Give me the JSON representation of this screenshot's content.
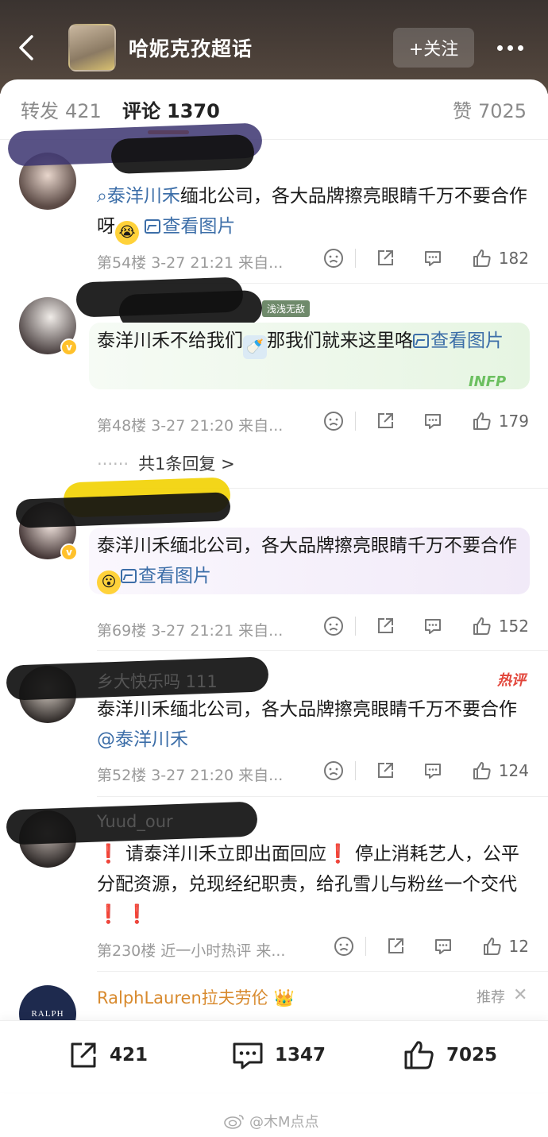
{
  "header": {
    "title": "哈妮克孜超话",
    "follow_label": "+关注",
    "icons": {
      "back": "chevron-left-icon",
      "more": "more-dots-icon"
    }
  },
  "tabs": [
    {
      "label": "转发",
      "count": "421"
    },
    {
      "label": "评论",
      "count": "1370"
    },
    {
      "label": "赞",
      "count": "7025"
    }
  ],
  "comments": [
    {
      "username": "",
      "text_link": "泰洋川禾",
      "text_rest": "缅北公司，各大品牌擦亮眼睛千万不要合作呀",
      "image_link": "查看图片",
      "meta": "第54楼 3-27 21:21 来自...",
      "likes": "182"
    },
    {
      "username": "",
      "badge_text": "浅浅无敌",
      "text": "泰洋川禾不给我们",
      "text_after": "那我们就来这里咯",
      "image_link": "查看图片",
      "meta": "第48楼 3-27 21:20 来自...",
      "likes": "179",
      "reply_link": "共1条回复 >"
    },
    {
      "username": "",
      "text": "泰洋川禾缅北公司，各大品牌擦亮眼睛千万不要合作",
      "image_link": "查看图片",
      "meta": "第69楼 3-27 21:21 来自...",
      "likes": "152"
    },
    {
      "username": "乡大快乐吗 111",
      "hot_label": "热评",
      "text": "泰洋川禾缅北公司，各大品牌擦亮眼睛千万不要合作",
      "mention": "@泰洋川禾",
      "meta": "第52楼 3-27 21:20 来自...",
      "likes": "124"
    },
    {
      "username": "Yuud_our",
      "text_1": "请泰洋川禾立即出面回应",
      "text_2": "停止消耗艺人，公平分配资源，兑现经纪职责，给孔雪儿与粉丝一个交代",
      "excl": "❗",
      "meta": "第230楼 近一小时热评 来...",
      "likes": "12"
    }
  ],
  "ad": {
    "name": "RalphLauren拉夫劳伦",
    "avatar_text": "RALPH",
    "tag": "推荐",
    "close": "✕"
  },
  "bottom_bar": {
    "repost_count": "421",
    "comment_count": "1347",
    "like_count": "7025"
  },
  "watermark": "@木M点点",
  "colors": {
    "accent": "#ff8200",
    "link": "#3c6ea8",
    "hot": "#e2463b",
    "vip": "#ffc12b"
  }
}
